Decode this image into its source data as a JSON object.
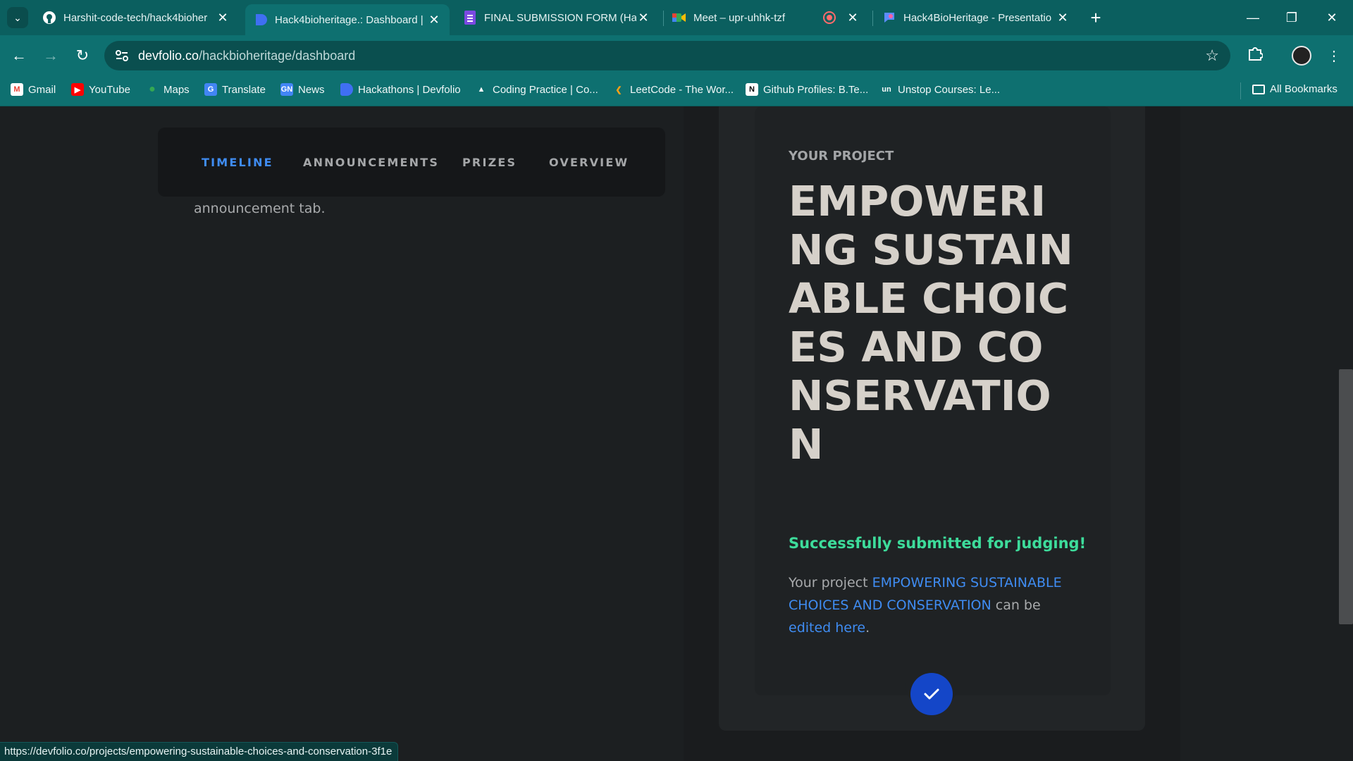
{
  "browser": {
    "tabs": [
      {
        "title": "Harshit-code-tech/hack4bioher",
        "icon": "github-icon"
      },
      {
        "title": "Hack4bioheritage.: Dashboard |",
        "icon": "devfolio-icon",
        "active": true
      },
      {
        "title": "FINAL SUBMISSION FORM (Hac",
        "icon": "google-forms-icon"
      },
      {
        "title": "Meet – upr-uhhk-tzf",
        "icon": "google-meet-icon",
        "recording": true
      },
      {
        "title": "Hack4BioHeritage - Presentatio",
        "icon": "presentation-icon"
      }
    ],
    "address": {
      "domain": "devfolio.co",
      "path": "/hackbioheritage/dashboard"
    },
    "bookmarks": [
      {
        "label": "Gmail",
        "icon": "gmail-icon"
      },
      {
        "label": "YouTube",
        "icon": "youtube-icon"
      },
      {
        "label": "Maps",
        "icon": "maps-icon"
      },
      {
        "label": "Translate",
        "icon": "translate-icon"
      },
      {
        "label": "News",
        "icon": "news-icon"
      },
      {
        "label": "Hackathons | Devfolio",
        "icon": "devfolio-icon"
      },
      {
        "label": "Coding Practice | Co...",
        "icon": "coding-practice-icon"
      },
      {
        "label": "LeetCode - The Wor...",
        "icon": "leetcode-icon"
      },
      {
        "label": "Github Profiles: B.Te...",
        "icon": "notion-icon"
      },
      {
        "label": "Unstop Courses: Le...",
        "icon": "unstop-icon"
      }
    ],
    "all_bookmarks_label": "All Bookmarks",
    "status_url": "https://devfolio.co/projects/empowering-sustainable-choices-and-conservation-3f1e"
  },
  "dashboard": {
    "tabs": [
      "TIMELINE",
      "ANNOUNCEMENTS",
      "PRIZES",
      "OVERVIEW"
    ],
    "active_tab": "TIMELINE",
    "announcement_text": "announcement tab."
  },
  "project": {
    "label": "YOUR PROJECT",
    "title": "EMPOWERING SUSTAINABLE CHOICES AND CONSERVATION",
    "success_message": "Successfully submitted for judging!",
    "desc_prefix": "Your project ",
    "desc_link": "EMPOWERING SUSTAINABLE CHOICES AND CONSERVATION",
    "desc_middle": " can be ",
    "desc_edit_link": "edited here",
    "desc_suffix": "."
  },
  "colors": {
    "accent_blue": "#3f8cf2",
    "success_green": "#3ddc9b",
    "check_blue": "#1446c8",
    "chrome_teal": "#0e7070"
  }
}
